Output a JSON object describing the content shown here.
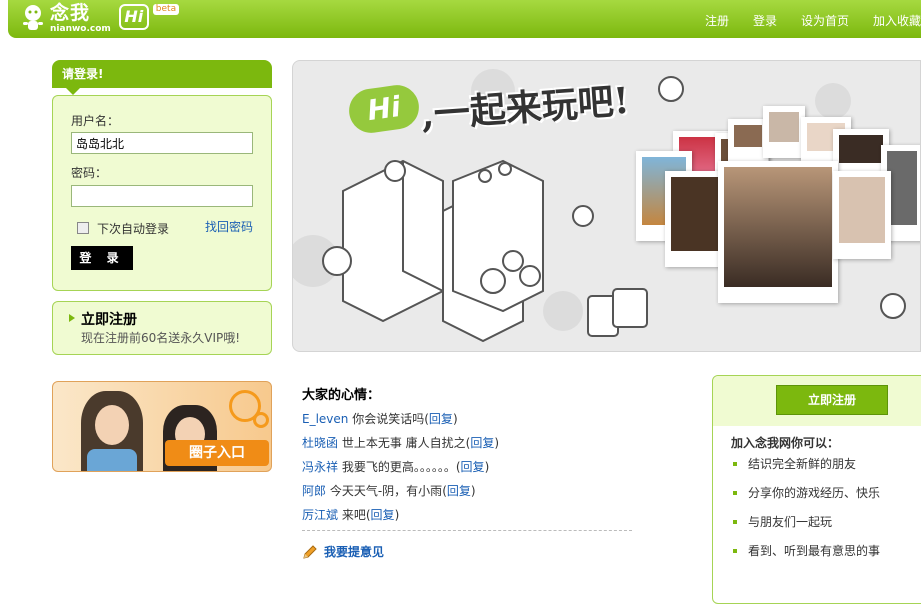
{
  "header": {
    "logo_cn": "念我",
    "logo_domain": "nianwo.com",
    "logo_hi": "Hi",
    "beta": "beta",
    "nav": [
      "注册",
      "登录",
      "设为首页",
      "加入收藏"
    ]
  },
  "login": {
    "title": "请登录!",
    "username_label": "用户名：",
    "username_value": "岛岛北北",
    "password_label": "密码：",
    "password_value": "",
    "remember_label": "下次自动登录",
    "forgot_label": "找回密码",
    "submit_label": "登 录"
  },
  "register": {
    "title": "立即注册",
    "subtitle": "现在注册前60名送永久VIP哦!"
  },
  "circle": {
    "label": "圈子入口"
  },
  "hero": {
    "hi": "Hi",
    "title": ",一起来玩吧!"
  },
  "moods": {
    "title": "大家的心情：",
    "reply_label": "回复",
    "items": [
      {
        "name": "E_leven",
        "text": "你会说笑话吗"
      },
      {
        "name": "杜晓函",
        "text": "世上本无事  庸人自扰之"
      },
      {
        "name": "冯永祥",
        "text": "我要飞的更高。。。。。。"
      },
      {
        "name": "阿郎",
        "text": "今天天气-阴，有小雨"
      },
      {
        "name": "厉江斌",
        "text": "来吧"
      }
    ],
    "suggest": "我要提意见"
  },
  "right_panel": {
    "button": "立即注册",
    "title": "加入念我网你可以：",
    "benefits": [
      "结识完全新鲜的朋友",
      "分享你的游戏经历、快乐",
      "与朋友们一起玩",
      "看到、听到最有意思的事"
    ]
  },
  "colors": {
    "brand_green": "#7cb80e",
    "light_green": "#f0fbd2",
    "link_blue": "#1a5fb4",
    "accent_orange": "#f08c16"
  }
}
